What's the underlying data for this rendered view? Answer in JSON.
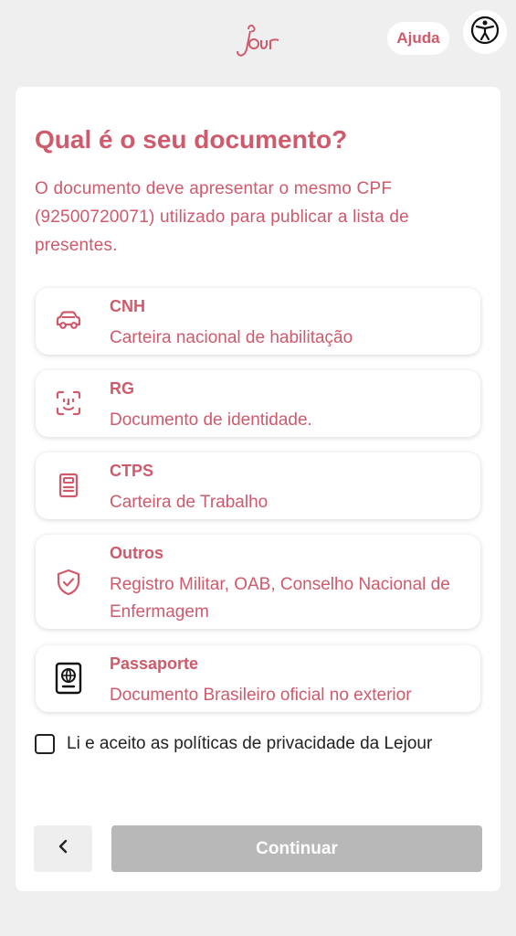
{
  "header": {
    "logo_text": "Lejour",
    "help_label": "Ajuda",
    "accessibility_icon": "accessibility-icon"
  },
  "main": {
    "title": "Qual é o seu documento?",
    "subtitle": "O documento deve apresentar o mesmo CPF (92500720071) utilizado para publicar a lista de presentes.",
    "options": [
      {
        "name": "CNH",
        "desc": "Carteira nacional de habilitação",
        "icon": "car-icon"
      },
      {
        "name": "RG",
        "desc": "Documento de identidade.",
        "icon": "face-id-icon"
      },
      {
        "name": "CTPS",
        "desc": "Carteira de Trabalho",
        "icon": "work-card-icon"
      },
      {
        "name": "Outros",
        "desc": "Registro Militar, OAB, Conselho Nacional de Enfermagem",
        "icon": "shield-check-icon"
      },
      {
        "name": "Passaporte",
        "desc": "Documento Brasileiro oficial no exterior",
        "icon": "passport-icon"
      }
    ],
    "consent_label": "Li e aceito as políticas de privacidade da Lejour",
    "consent_checked": false
  },
  "footer": {
    "back_icon": "chevron-left-icon",
    "continue_label": "Continuar",
    "continue_enabled": false
  },
  "colors": {
    "accent": "#cf5a6c",
    "disabled_button": "#b8b8b8",
    "background": "#efefef"
  }
}
